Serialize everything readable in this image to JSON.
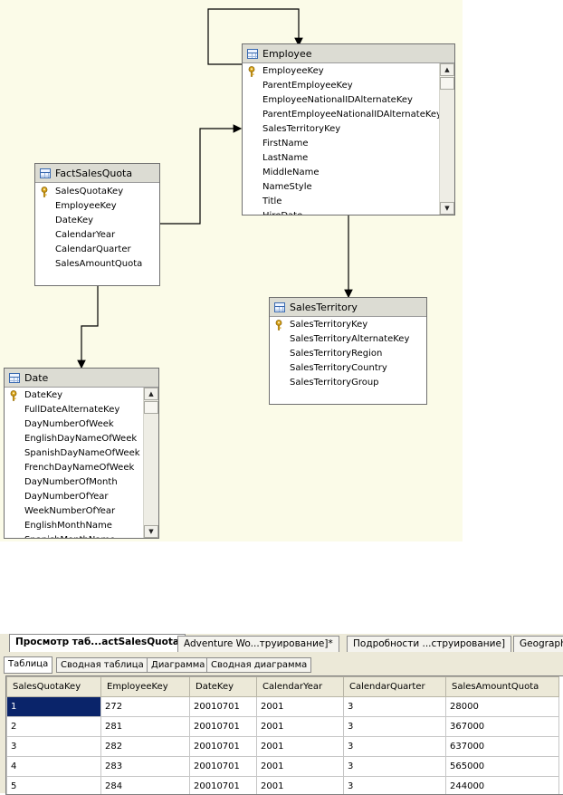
{
  "diagram": {
    "tables": {
      "employee": {
        "name": "Employee",
        "columns": [
          "EmployeeKey",
          "ParentEmployeeKey",
          "EmployeeNationalIDAlternateKey",
          "ParentEmployeeNationalIDAlternateKey",
          "SalesTerritoryKey",
          "FirstName",
          "LastName",
          "MiddleName",
          "NameStyle",
          "Title",
          "HireDate"
        ],
        "key_column": "EmployeeKey"
      },
      "fact": {
        "name": "FactSalesQuota",
        "columns": [
          "SalesQuotaKey",
          "EmployeeKey",
          "DateKey",
          "CalendarYear",
          "CalendarQuarter",
          "SalesAmountQuota"
        ],
        "key_column": "SalesQuotaKey"
      },
      "territory": {
        "name": "SalesTerritory",
        "columns": [
          "SalesTerritoryKey",
          "SalesTerritoryAlternateKey",
          "SalesTerritoryRegion",
          "SalesTerritoryCountry",
          "SalesTerritoryGroup"
        ],
        "key_column": "SalesTerritoryKey"
      },
      "date": {
        "name": "Date",
        "columns": [
          "DateKey",
          "FullDateAlternateKey",
          "DayNumberOfWeek",
          "EnglishDayNameOfWeek",
          "SpanishDayNameOfWeek",
          "FrenchDayNameOfWeek",
          "DayNumberOfMonth",
          "DayNumberOfYear",
          "WeekNumberOfYear",
          "EnglishMonthName",
          "SpanishMonthName"
        ],
        "key_column": "DateKey"
      }
    }
  },
  "document_tabs": [
    "Просмотр таб...actSalesQuota",
    "Adventure Wo...труирование]*",
    "Подробности ...струирование]",
    "Geograph"
  ],
  "view_tabs": [
    "Таблица",
    "Сводная таблица",
    "Диаграмма",
    "Сводная диаграмма"
  ],
  "grid": {
    "headers": [
      "SalesQuotaKey",
      "EmployeeKey",
      "DateKey",
      "CalendarYear",
      "CalendarQuarter",
      "SalesAmountQuota"
    ],
    "rows": [
      [
        "1",
        "272",
        "20010701",
        "2001",
        "3",
        "28000"
      ],
      [
        "2",
        "281",
        "20010701",
        "2001",
        "3",
        "367000"
      ],
      [
        "3",
        "282",
        "20010701",
        "2001",
        "3",
        "637000"
      ],
      [
        "4",
        "283",
        "20010701",
        "2001",
        "3",
        "565000"
      ],
      [
        "5",
        "284",
        "20010701",
        "2001",
        "3",
        "244000"
      ]
    ]
  },
  "icons": {
    "key": "key-icon",
    "table": "table-icon",
    "scroll_up": "scroll-up-icon",
    "scroll_down": "scroll-down-icon"
  },
  "colors": {
    "canvas": "#fbfbe8",
    "header": "#dcdcd3",
    "selection": "#0a246a"
  }
}
